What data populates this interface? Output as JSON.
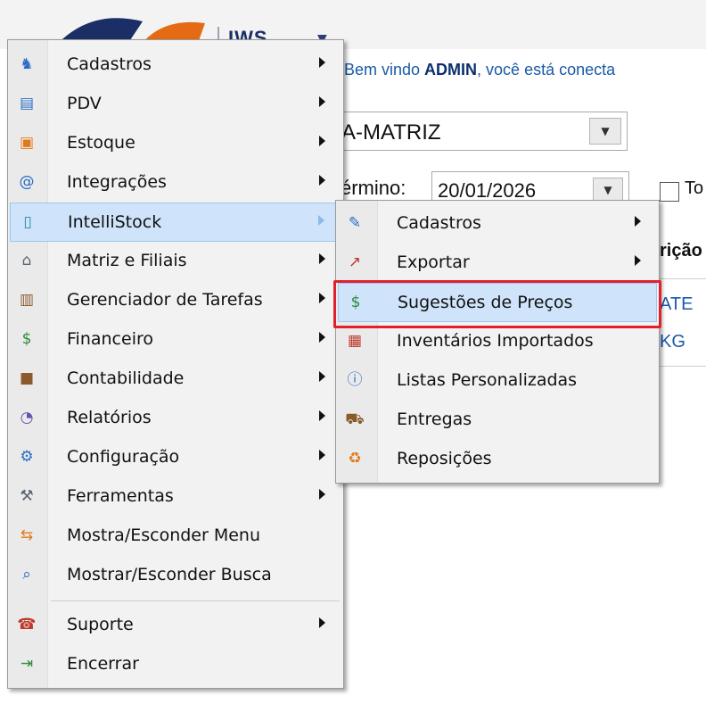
{
  "app": {
    "logo_text": "IWS",
    "welcome_prefix": "Bem vindo ",
    "welcome_user": "ADMIN",
    "welcome_suffix": ", você está conecta",
    "company_value": "A-MATRIZ",
    "term_label": "érmino:",
    "date_value": "20/01/2026",
    "checkbox_label": "To",
    "column_header": "rição",
    "row1_text": "ATE",
    "row2_text": "KG"
  },
  "menu": {
    "items": [
      {
        "label": "Cadastros",
        "icon": "cadastros-icon",
        "submenu": true
      },
      {
        "label": "PDV",
        "icon": "pdv-register-icon",
        "submenu": true
      },
      {
        "label": "Estoque",
        "icon": "estoque-boxes-icon",
        "submenu": true
      },
      {
        "label": "Integrações",
        "icon": "at-sign-icon",
        "submenu": true
      },
      {
        "label": "IntelliStock",
        "icon": "intellistock-icon",
        "submenu": true,
        "active": true
      },
      {
        "label": "Matriz e Filiais",
        "icon": "house-icon",
        "submenu": true
      },
      {
        "label": "Gerenciador de Tarefas",
        "icon": "clipboard-icon",
        "submenu": true
      },
      {
        "label": "Financeiro",
        "icon": "money-bag-icon",
        "submenu": true
      },
      {
        "label": "Contabilidade",
        "icon": "briefcase-icon",
        "submenu": true
      },
      {
        "label": "Relatórios",
        "icon": "reports-icon",
        "submenu": true
      },
      {
        "label": "Configuração",
        "icon": "configuration-icon",
        "submenu": true
      },
      {
        "label": "Ferramentas",
        "icon": "hammer-icon",
        "submenu": true
      },
      {
        "label": "Mostra/Esconder Menu",
        "icon": "toggle-menu-icon",
        "submenu": false
      },
      {
        "label": "Mostrar/Esconder Busca",
        "icon": "magnifier-icon",
        "submenu": false
      },
      {
        "label": "Suporte",
        "icon": "telephone-icon",
        "submenu": true
      },
      {
        "label": "Encerrar",
        "icon": "exit-door-icon",
        "submenu": false
      }
    ]
  },
  "submenu": {
    "items": [
      {
        "label": "Cadastros",
        "icon": "tools-icon",
        "submenu": true
      },
      {
        "label": "Exportar",
        "icon": "export-icon",
        "submenu": true
      },
      {
        "label": "Sugestões de Preços",
        "icon": "price-suggestion-icon",
        "submenu": false,
        "active": true
      },
      {
        "label": "Inventários Importados",
        "icon": "inventory-icon",
        "submenu": false
      },
      {
        "label": "Listas Personalizadas",
        "icon": "info-icon",
        "submenu": false
      },
      {
        "label": "Entregas",
        "icon": "delivery-icon",
        "submenu": false
      },
      {
        "label": "Reposições",
        "icon": "replenishment-icon",
        "submenu": false
      }
    ]
  },
  "colors": {
    "highlight": "#cfe4fb",
    "annotation_red": "#e0202c",
    "link_blue": "#1a5aa8"
  }
}
